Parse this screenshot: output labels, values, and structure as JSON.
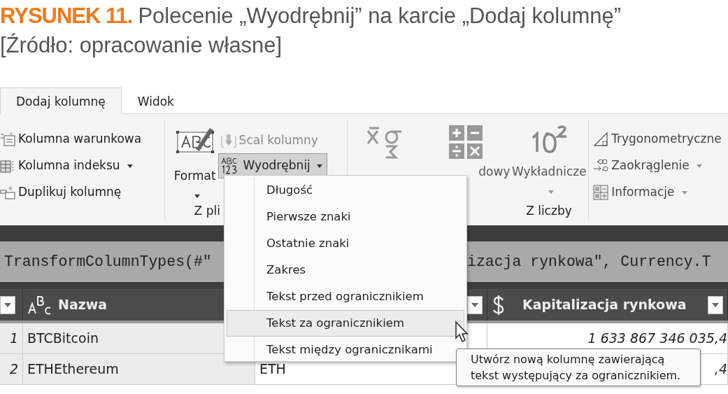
{
  "caption": {
    "label": "RYSUNEK 11.",
    "title": "Polecenie „Wyodrębnij” na karcie „Dodaj kolumnę”",
    "source": "[Źródło: opracowanie własne]"
  },
  "tabs": [
    {
      "label": "Dodaj kolumnę",
      "selected": true
    },
    {
      "label": "Widok",
      "selected": false
    }
  ],
  "ribbon_general": {
    "items": [
      {
        "kind": "conditional",
        "label": "Kolumna warunkowa",
        "dropdown": false
      },
      {
        "kind": "index",
        "label": "Kolumna indeksu",
        "dropdown": true
      },
      {
        "kind": "duplicate",
        "label": "Duplikuj kolumnę",
        "dropdown": false
      }
    ]
  },
  "ribbon_text": {
    "format": {
      "label": "Format"
    },
    "merge": {
      "label": "Scal kolumny",
      "disabled": true
    },
    "extract": {
      "label": "Wyodrębnij",
      "pressed": true
    },
    "group_label": "Z pli"
  },
  "ribbon_number": {
    "buttons": [
      {
        "kind": "statistics"
      },
      {
        "kind": "standard",
        "label": "dowy"
      },
      {
        "kind": "exponent",
        "label": "Wykładnicze"
      }
    ],
    "group_label": "Z liczby"
  },
  "ribbon_more": {
    "items": [
      {
        "kind": "trig",
        "label": "Trygonometryczne",
        "dropdown": false
      },
      {
        "kind": "round",
        "label": "Zaokrąglenie",
        "dropdown": true
      },
      {
        "kind": "info",
        "label": "Informacje",
        "dropdown": true
      }
    ]
  },
  "formula": {
    "left": "TransformColumnTypes(#\"",
    "right": "izacja rynkowa\", Currency.T"
  },
  "table": {
    "columns": [
      {
        "kind": "text",
        "label": "Nazwa",
        "filter": false
      },
      {
        "kind": "covered",
        "filter": true
      },
      {
        "kind": "currency",
        "label": "Kapitalizacja rynkowa",
        "filter": true
      }
    ],
    "rows": [
      {
        "number": "1",
        "name": "BTCBitcoin",
        "value": "1 633 867 346 035,4"
      },
      {
        "number": "2",
        "name": "ETHEthereum",
        "symbol": "ETH",
        "value": ",4"
      }
    ]
  },
  "extract_menu": {
    "items": [
      {
        "label": "Długość",
        "selected": false
      },
      {
        "label": "Pierwsze znaki",
        "selected": false
      },
      {
        "label": "Ostatnie znaki",
        "selected": false
      },
      {
        "label": "Zakres",
        "selected": false
      },
      {
        "label": "Tekst przed ogranicznikiem",
        "selected": false
      },
      {
        "label": "Tekst za ogranicznikiem",
        "selected": true
      },
      {
        "label": "Tekst między ogranicznikami",
        "selected": false
      }
    ]
  },
  "tooltip": {
    "lines": [
      "Utwórz nową kolumnę zawierającą",
      "tekst występujący za ogranicznikiem."
    ]
  }
}
